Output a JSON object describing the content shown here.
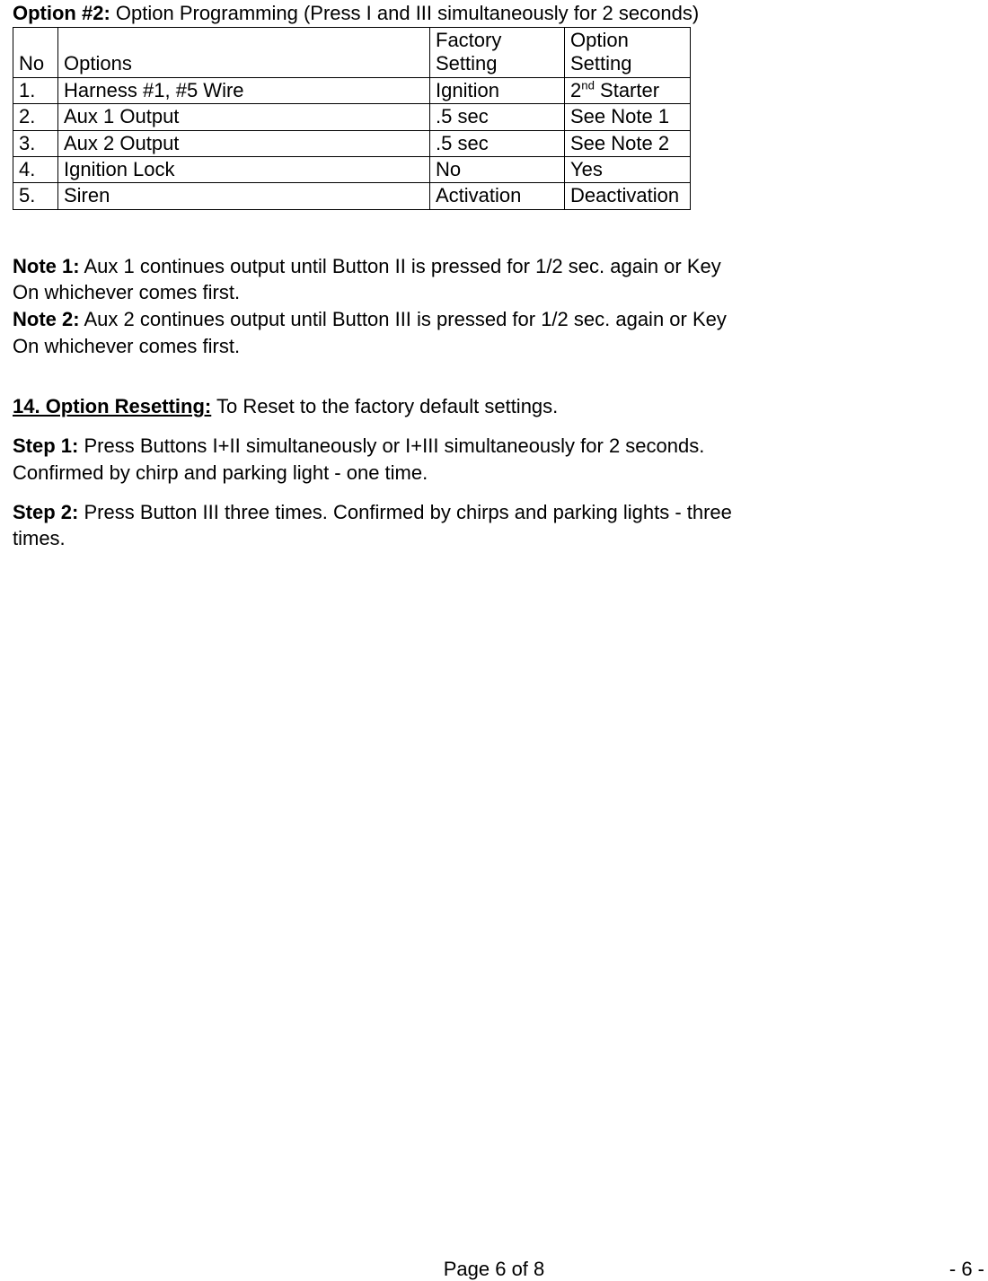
{
  "title": {
    "label": "Option #2:",
    "text": " Option Programming (Press I and III simultaneously for 2 seconds)"
  },
  "table": {
    "headers": {
      "no": "No",
      "options": "Options",
      "factory": "Factory Setting",
      "setting": "Option Setting"
    },
    "rows": [
      {
        "no": "1.",
        "option": "Harness #1, #5 Wire",
        "factory": "Ignition",
        "setting_pre": "2",
        "setting_sup": "nd",
        "setting_post": " Starter"
      },
      {
        "no": "2.",
        "option": "Aux 1 Output",
        "factory": ".5 sec",
        "setting": "See Note 1"
      },
      {
        "no": "3.",
        "option": "Aux 2 Output",
        "factory": ".5 sec",
        "setting": "See Note 2"
      },
      {
        "no": "4.",
        "option": "Ignition Lock",
        "factory": "No",
        "setting": "Yes"
      },
      {
        "no": "5.",
        "option": "Siren",
        "factory": "Activation",
        "setting": "Deactivation"
      }
    ]
  },
  "notes": {
    "n1": {
      "label": "Note 1:",
      "text": " Aux 1 continues output until Button II is pressed for 1/2 sec. again or Key On whichever comes first."
    },
    "n2": {
      "label": "Note 2:",
      "text": " Aux 2 continues output until Button III is pressed for 1/2 sec. again or Key On whichever comes first."
    }
  },
  "section14": {
    "heading": {
      "label": "14. Option Resetting:",
      "text": " To Reset to the factory default settings."
    },
    "step1": {
      "label": "Step 1:",
      "text": "  Press Buttons I+II simultaneously or I+III simultaneously for 2 seconds. Confirmed by chirp and parking light - one time."
    },
    "step2": {
      "label": "Step 2:",
      "text": "  Press Button III three times. Confirmed by chirps and parking lights - three times."
    }
  },
  "footer": {
    "center": "Page 6 of 8",
    "right": "- 6 -"
  }
}
